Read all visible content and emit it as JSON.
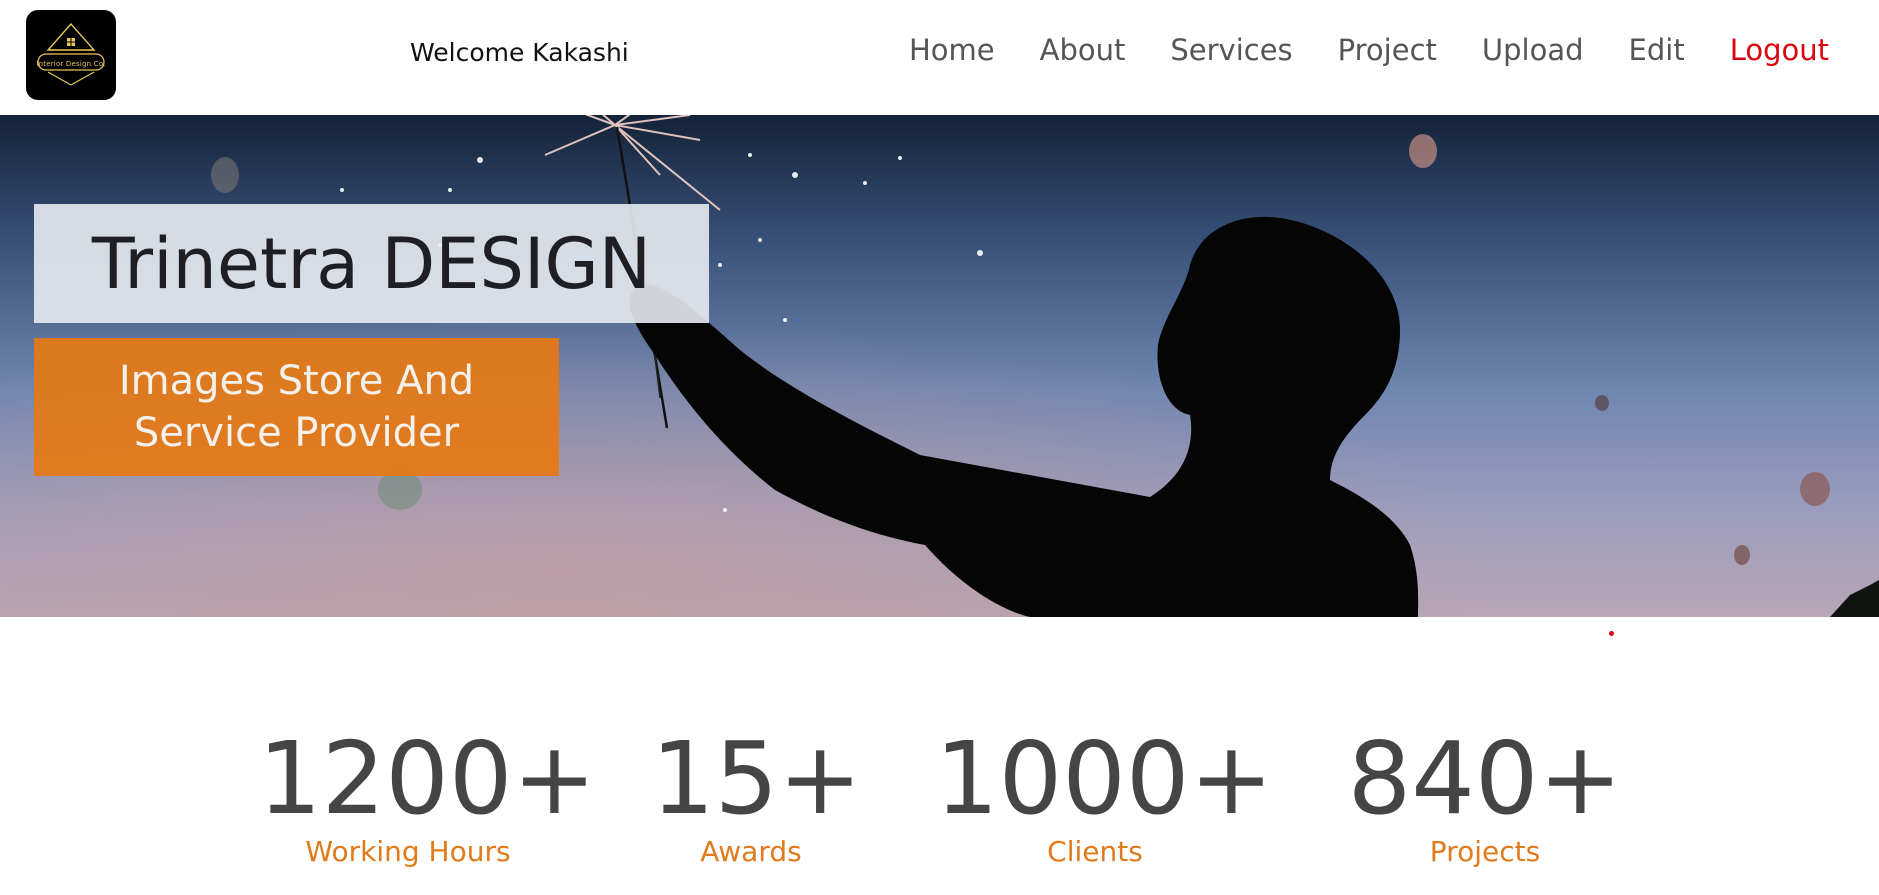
{
  "header": {
    "logo": {
      "icon": "house-logo-icon",
      "text": "Interior Design Co."
    },
    "welcome_text": "Welcome Kakashi",
    "nav": [
      {
        "label": "Home"
      },
      {
        "label": "About"
      },
      {
        "label": "Services"
      },
      {
        "label": "Project"
      },
      {
        "label": "Upload"
      },
      {
        "label": "Edit"
      },
      {
        "label": "Logout"
      }
    ]
  },
  "hero": {
    "title": "Trinetra DESIGN",
    "subtitle": "Images Store And Service Provider",
    "background_image": "silhouette-with-sparkler-photo"
  },
  "stats": [
    {
      "value": "1200+",
      "label": "Working Hours"
    },
    {
      "value": "15+",
      "label": "Awards"
    },
    {
      "value": "1000+",
      "label": "Clients"
    },
    {
      "value": "840+",
      "label": "Projects"
    }
  ],
  "colors": {
    "accent_orange": "#e07a1b",
    "logout_red": "#d9050f",
    "nav_gray": "#555555",
    "stat_gray": "#454545"
  }
}
